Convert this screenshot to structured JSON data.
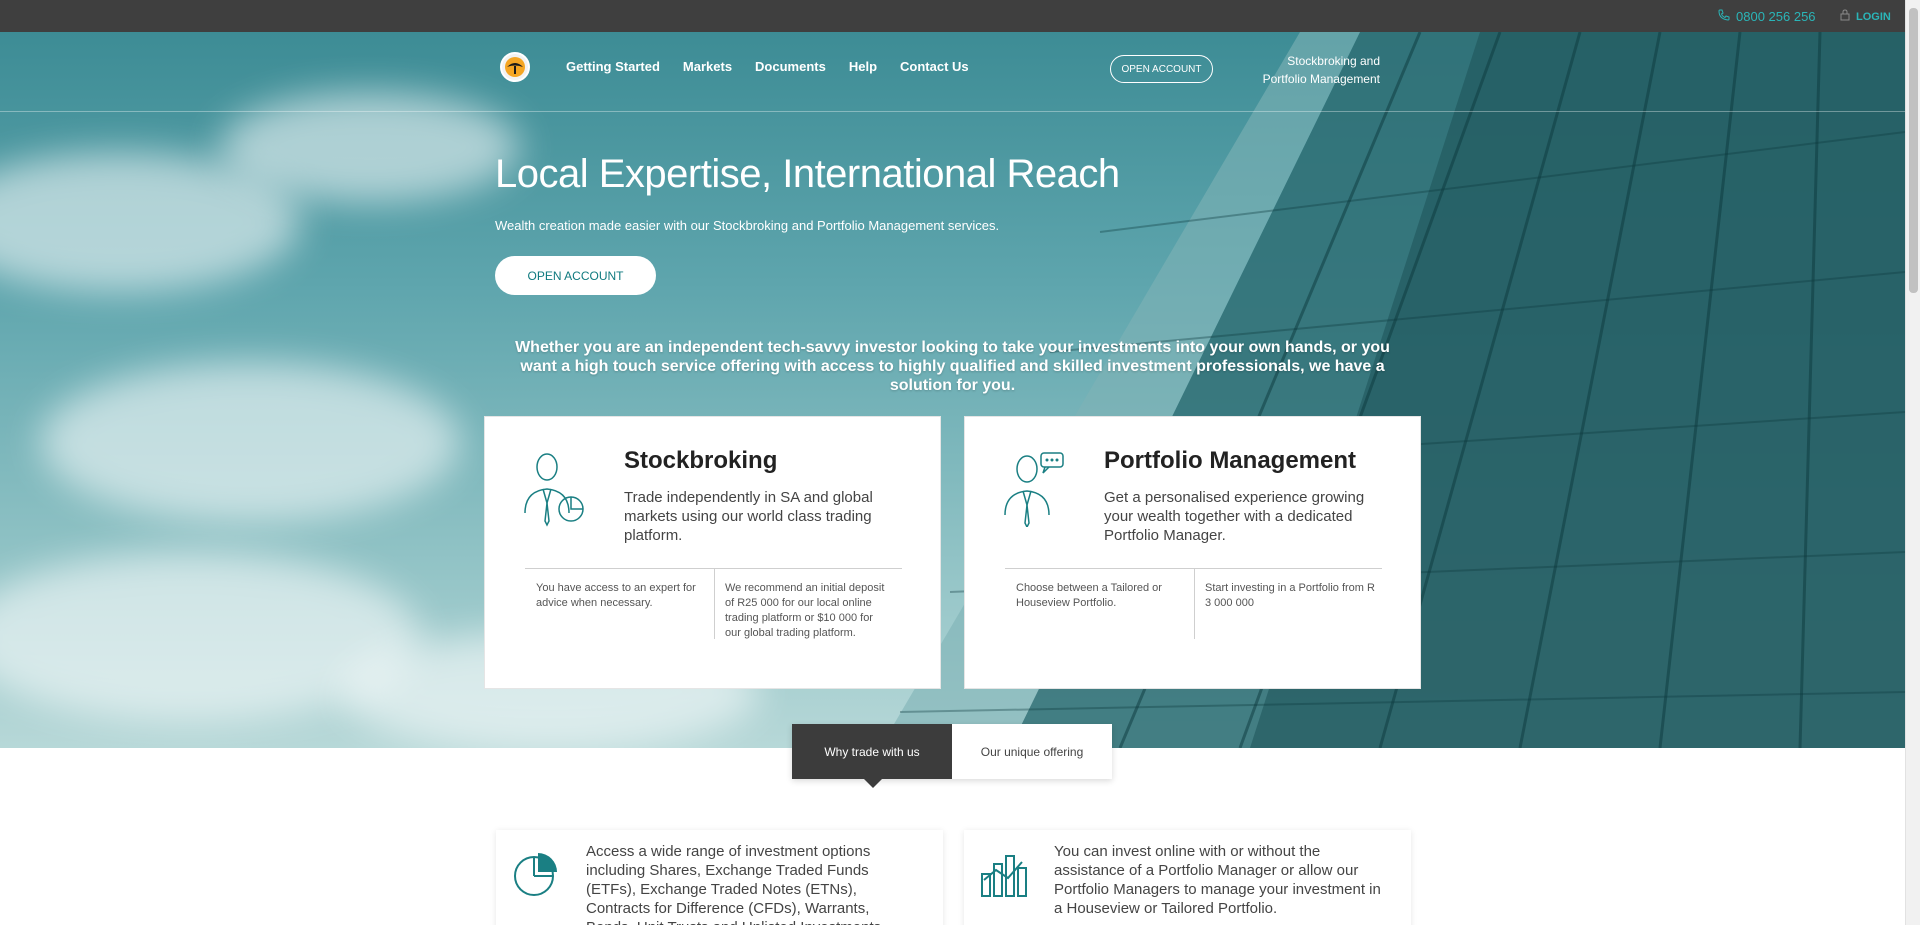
{
  "topbar": {
    "phone": "0800 256 256",
    "login": "LOGIN"
  },
  "nav": {
    "links": [
      "Getting Started",
      "Markets",
      "Documents",
      "Help",
      "Contact Us"
    ],
    "open_account": "OPEN ACCOUNT",
    "brand_line1": "Stockbroking and",
    "brand_line2": "Portfolio Management"
  },
  "hero": {
    "title": "Local Expertise, International Reach",
    "subtitle": "Wealth creation made easier with our Stockbroking and Portfolio Management services.",
    "button": "OPEN ACCOUNT",
    "tagline": "Whether you are an independent tech-savvy investor looking to take your investments into your own hands, or you want a high touch service offering with access to highly qualified and skilled investment professionals, we have a solution for you."
  },
  "cards": [
    {
      "title": "Stockbroking",
      "description": "Trade independently in SA and global markets using our world class trading platform.",
      "col1": "You have access to an expert for advice when necessary.",
      "col2": "We recommend an initial deposit of R25 000 for our local online trading platform or $10 000 for our global trading platform."
    },
    {
      "title": "Portfolio Management",
      "description": "Get a personalised experience growing your wealth together with a dedicated Portfolio Manager.",
      "col1": "Choose between a Tailored or Houseview Portfolio.",
      "col2": "Start investing in a Portfolio from R 3 000 000"
    }
  ],
  "tabs": {
    "active": "Why trade with us",
    "inactive": "Our unique offering"
  },
  "features": [
    {
      "text": "Access a wide range of investment options including Shares, Exchange Traded Funds (ETFs), Exchange Traded Notes (ETNs), Contracts for Difference (CFDs), Warrants, Bonds, Unit Trusts and Unlisted Investments."
    },
    {
      "text": "You can invest online with or without the assistance of a Portfolio Manager or allow our Portfolio Managers to manage your investment in a Houseview or Tailored Portfolio."
    }
  ],
  "colors": {
    "accent": "#2ab5b8",
    "teal_dark": "#0f7a7f",
    "topbar": "#3f3f3f",
    "tab_active": "#3c3c3c"
  }
}
